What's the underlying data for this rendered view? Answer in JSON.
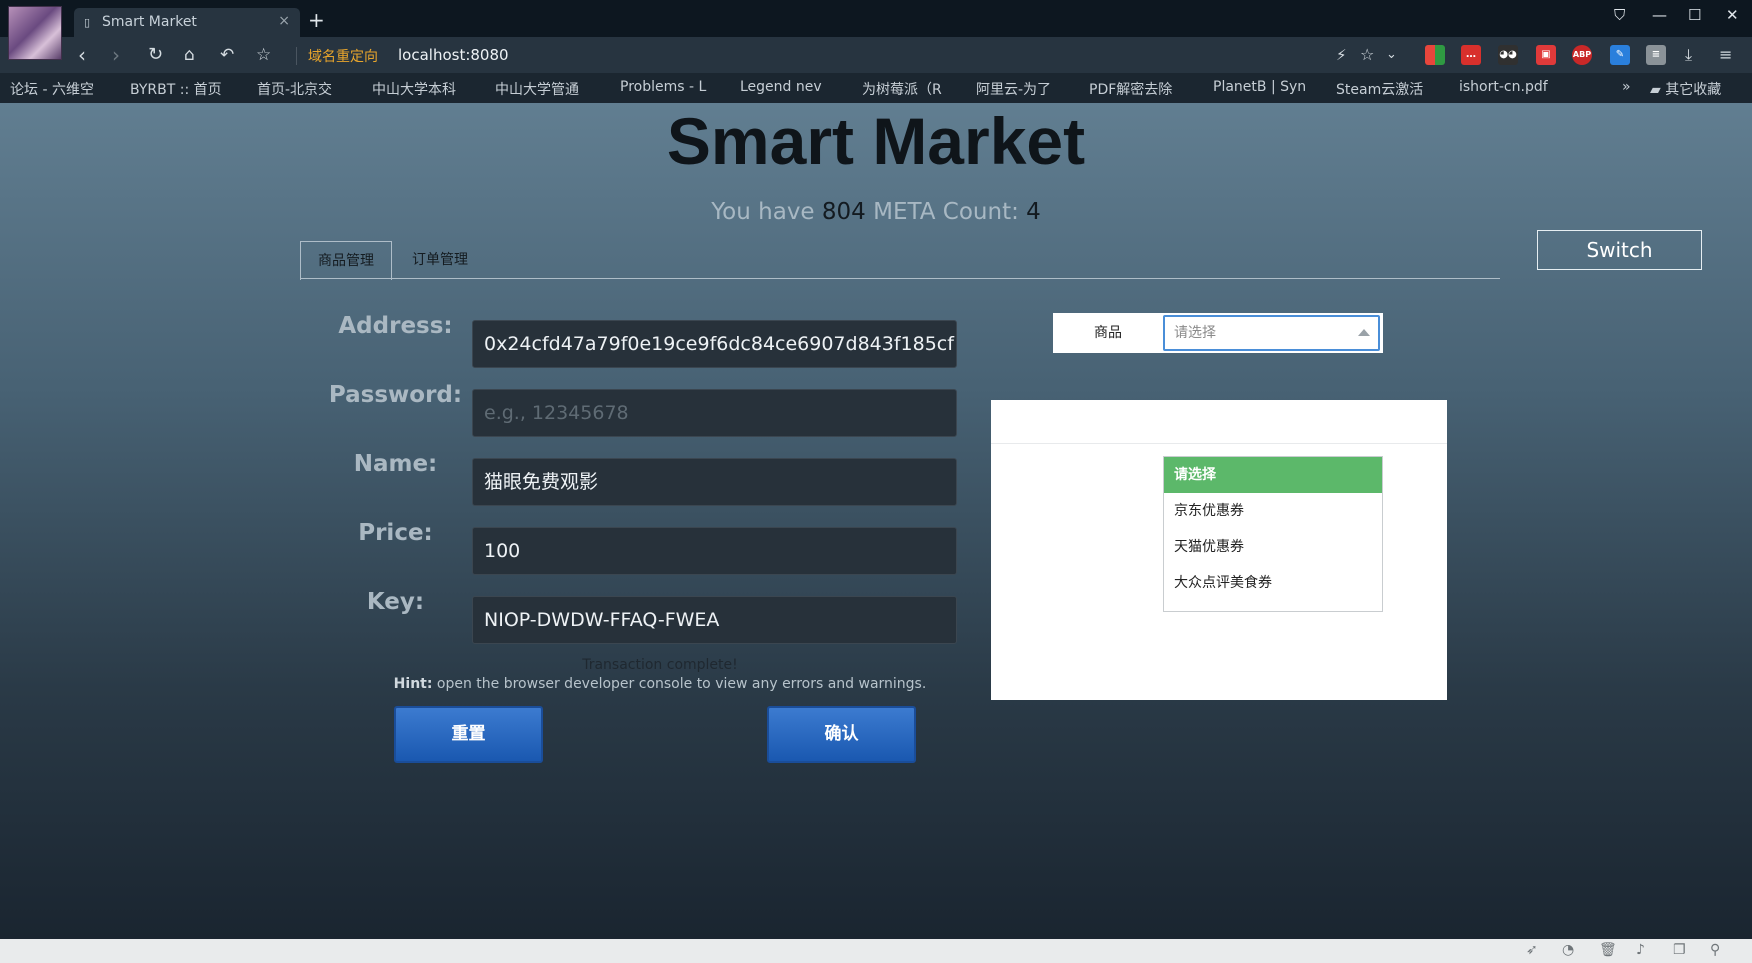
{
  "browser": {
    "tab_title": "Smart Market",
    "tab_close": "×",
    "new_tab": "+",
    "redirect_label": "域名重定向",
    "url": "localhost:8080",
    "bookmarks": [
      "论坛 - 六维空",
      "BYRBT :: 首页",
      "首页-北京交",
      "中山大学本科",
      "中山大学管通",
      "Problems - L",
      "Legend nev",
      "为树莓派（R",
      "阿里云-为了",
      "PDF解密去除",
      "PlanetB | Syn",
      "Steam云激活",
      "ishort-cn.pdf"
    ],
    "more_bookmarks": "»",
    "other_bookmarks": "其它收藏"
  },
  "header": {
    "title": "Smart Market",
    "balance_prefix": "You have",
    "balance": "804",
    "meta_label": "META Count:",
    "meta_count": "4"
  },
  "tabs": [
    "商品管理",
    "订单管理"
  ],
  "switch_label": "Switch",
  "form": {
    "address_label": "Address:",
    "address_value": "0x24cfd47a79f0e19ce9f6dc84ce6907d843f185cf",
    "password_label": "Password:",
    "password_placeholder": "e.g., 12345678",
    "name_label": "Name:",
    "name_value": "猫眼免费观影",
    "price_label": "Price:",
    "price_value": "100",
    "key_label": "Key:",
    "key_value": "NIOP-DWDW-FFAQ-FWEA"
  },
  "status": {
    "message": "Transaction complete!",
    "hint_label": "Hint:",
    "hint_text": "open the browser developer console to view any errors and warnings."
  },
  "buttons": {
    "reset": "重置",
    "confirm": "确认"
  },
  "product_select": {
    "label": "商品",
    "placeholder": "请选择",
    "options": [
      "请选择",
      "京东优惠券",
      "天猫优惠券",
      "大众点评美食券"
    ],
    "highlighted_color": "#5cb86a"
  },
  "colors": {
    "accent_button": "#2a68c0",
    "select_border": "#4a8ed8"
  }
}
